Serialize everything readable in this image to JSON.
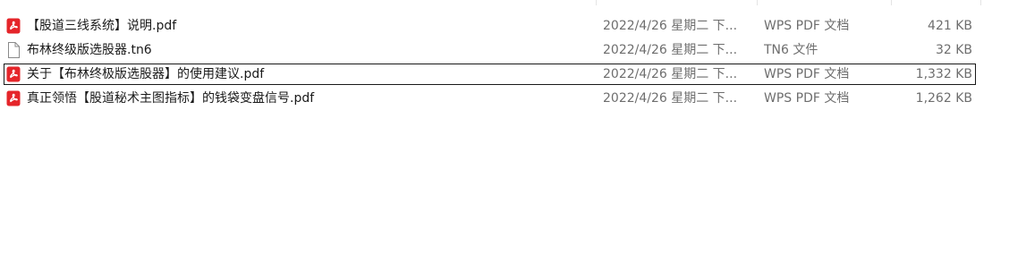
{
  "files": [
    {
      "name": "【股道三线系统】说明.pdf",
      "modified": "2022/4/26 星期二 下...",
      "type": "WPS PDF 文档",
      "size": "421 KB",
      "icon": "wps-pdf-icon",
      "selected": false
    },
    {
      "name": "布林终级版选股器.tn6",
      "modified": "2022/4/26 星期二 下...",
      "type": "TN6 文件",
      "size": "32 KB",
      "icon": "blank-file-icon",
      "selected": false
    },
    {
      "name": "关于【布林终极版选股器】的使用建议.pdf",
      "modified": "2022/4/26 星期二 下...",
      "type": "WPS PDF 文档",
      "size": "1,332 KB",
      "icon": "wps-pdf-icon",
      "selected": true
    },
    {
      "name": "真正领悟【股道秘术主图指标】的钱袋变盘信号.pdf",
      "modified": "2022/4/26 星期二 下...",
      "type": "WPS PDF 文档",
      "size": "1,262 KB",
      "icon": "wps-pdf-icon",
      "selected": false
    }
  ],
  "colors": {
    "pdf_icon_red": "#e5252a",
    "secondary_text": "#6e6e6e",
    "selection_border": "#1a1a1a"
  }
}
